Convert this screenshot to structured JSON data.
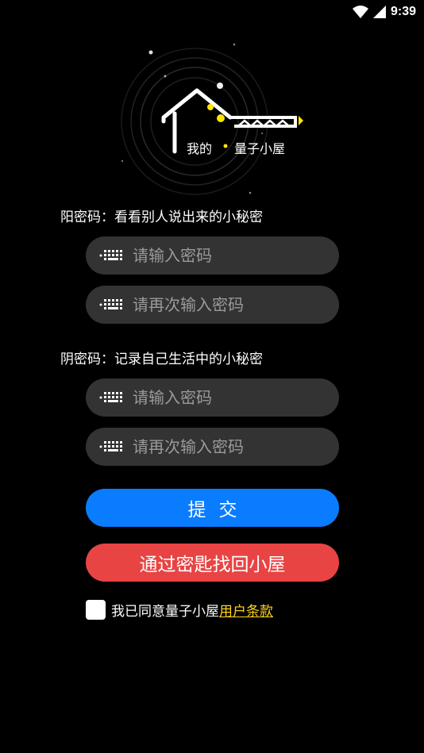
{
  "status": {
    "time": "9:39"
  },
  "logo": {
    "text_left": "我的",
    "text_right": "量子小屋"
  },
  "yang": {
    "label": "阳密码：看看别人说出来的小秘密",
    "password_placeholder": "请输入密码",
    "confirm_placeholder": "请再次输入密码"
  },
  "yin": {
    "label": "阴密码：记录自己生活中的小秘密",
    "password_placeholder": "请输入密码",
    "confirm_placeholder": "请再次输入密码"
  },
  "buttons": {
    "submit": "提交",
    "recover": "通过密匙找回小屋"
  },
  "agreement": {
    "text": "我已同意量子小屋",
    "link": "用户条款",
    "checked": false
  },
  "colors": {
    "background": "#000000",
    "field": "#333333",
    "submit": "#0a7cff",
    "recover": "#e84444",
    "link": "#ffd21f",
    "accent_dot": "#ffe600"
  }
}
